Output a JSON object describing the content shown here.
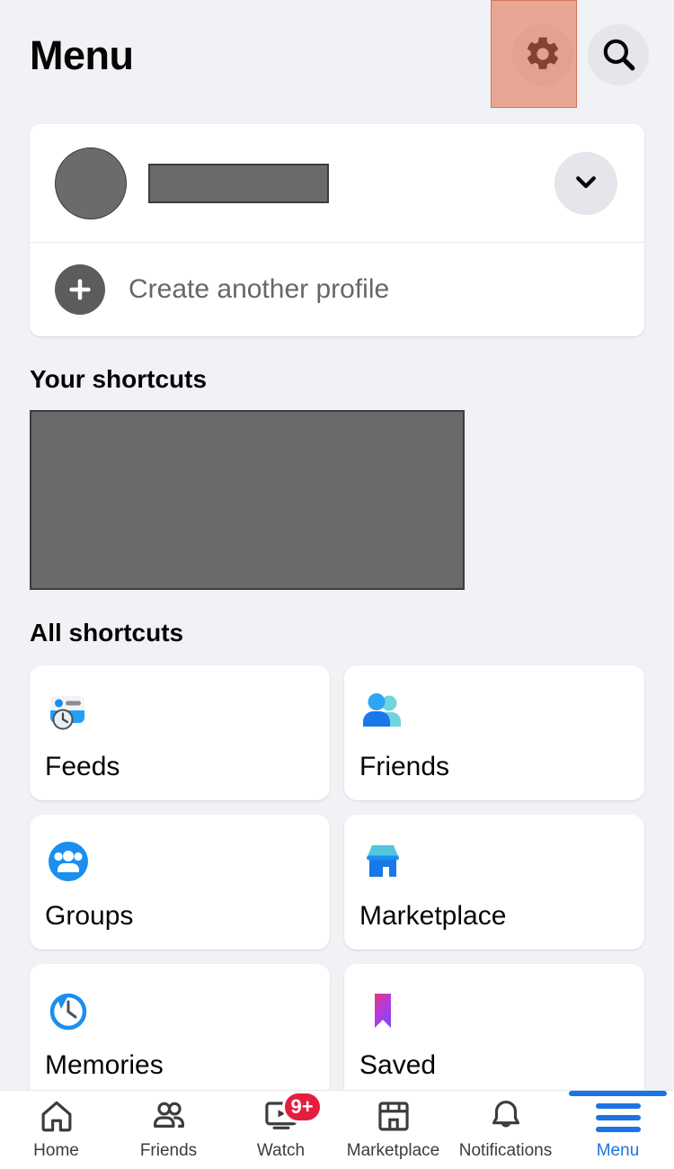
{
  "header": {
    "title": "Menu",
    "settings_icon": "gear-icon",
    "search_icon": "search-icon",
    "highlight_color": "#e26e50"
  },
  "profile": {
    "name": "",
    "name_redacted": true,
    "avatar_icon": "avatar-placeholder",
    "expand_icon": "chevron-down-icon",
    "create_label": "Create another profile",
    "create_icon": "plus-icon"
  },
  "your_shortcuts": {
    "title": "Your shortcuts",
    "redacted": true
  },
  "all_shortcuts": {
    "title": "All shortcuts",
    "tiles": [
      {
        "label": "Feeds",
        "icon": "feeds-icon"
      },
      {
        "label": "Friends",
        "icon": "friends-icon"
      },
      {
        "label": "Groups",
        "icon": "groups-icon"
      },
      {
        "label": "Marketplace",
        "icon": "marketplace-icon"
      },
      {
        "label": "Memories",
        "icon": "memories-icon"
      },
      {
        "label": "Saved",
        "icon": "saved-icon"
      }
    ]
  },
  "bottom_nav": {
    "active_color": "#1b74e4",
    "items": [
      {
        "label": "Home",
        "icon": "home-icon",
        "badge": "",
        "active": false
      },
      {
        "label": "Friends",
        "icon": "friends-icon",
        "badge": "",
        "active": false
      },
      {
        "label": "Watch",
        "icon": "watch-icon",
        "badge": "9+",
        "active": false
      },
      {
        "label": "Marketplace",
        "icon": "marketplace-icon",
        "badge": "",
        "active": false
      },
      {
        "label": "Notifications",
        "icon": "bell-icon",
        "badge": "",
        "active": false
      },
      {
        "label": "Menu",
        "icon": "hamburger-icon",
        "badge": "",
        "active": true
      }
    ]
  }
}
